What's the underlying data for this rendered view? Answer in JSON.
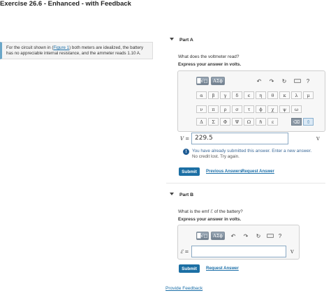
{
  "exercise_title": "Exercise 26.6 - Enhanced - with Feedback",
  "problem": {
    "text_before": "For the circuit shown in (",
    "figure_link": "Figure 1",
    "text_after": ") both meters are idealized, the battery has no appreciable internal resistance, and the ammeter reads 1.10 A."
  },
  "part_a": {
    "label": "Part A",
    "question": "What does the voltmeter read?",
    "instruction": "Express your answer in volts.",
    "toolbar": {
      "template_button": "█√□",
      "greek_button": "AΣϕ",
      "undo": "↶",
      "redo": "↷",
      "reset": "↻",
      "help": "?"
    },
    "symbols_row1": [
      "α",
      "β",
      "γ",
      "δ",
      "ϵ",
      "η",
      "θ",
      "κ",
      "λ",
      "μ"
    ],
    "symbols_row2": [
      "ν",
      "π",
      "ρ",
      "σ",
      "τ",
      "ϕ",
      "χ",
      "ψ",
      "ω"
    ],
    "symbols_row3": [
      "Δ",
      "Σ",
      "Φ",
      "Ψ",
      "Ω",
      "ℏ",
      "ε"
    ],
    "answer_var": "V =",
    "answer_value": "229.5",
    "unit": "V",
    "feedback_main": "You have already submitted this answer. Enter a new answer.",
    "feedback_sub": "No credit lost. Try again.",
    "submit": "Submit",
    "previous_answers": "Previous Answers",
    "request_answer": "Request Answer"
  },
  "part_b": {
    "label": "Part B",
    "question": "What is the emf ℰ of the battery?",
    "instruction": "Express your answer in volts.",
    "toolbar": {
      "template_button": "█√□",
      "greek_button": "AΣϕ",
      "undo": "↶",
      "redo": "↷",
      "reset": "↻",
      "help": "?"
    },
    "answer_var": "ℰ =",
    "answer_value": "",
    "unit": "V",
    "submit": "Submit",
    "request_answer": "Request Answer"
  },
  "provide_feedback": "Provide Feedback"
}
